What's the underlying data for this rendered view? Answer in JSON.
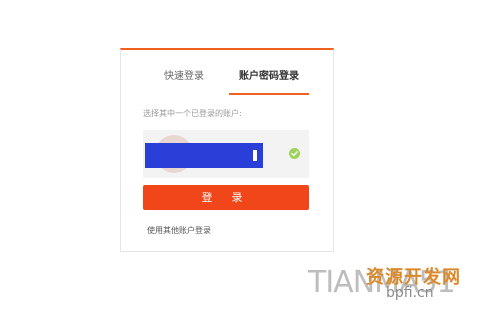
{
  "tabs": {
    "quick_login": "快速登录",
    "account_password_login": "账户密码登录"
  },
  "hint": "选择其中一个已登录的账户:",
  "account": {
    "name": ""
  },
  "login_button": "登 录",
  "other_account_link": "使用其他账户登录",
  "watermark": {
    "latin": "TIANMA51",
    "chinese": "资源开发网",
    "site": "bpfi.cn"
  },
  "colors": {
    "accent": "#f0601e",
    "button": "#f0461a",
    "redaction": "#2a3fd8",
    "check": "#9fd25b"
  },
  "icons": {
    "selected": "check-circle-icon"
  }
}
